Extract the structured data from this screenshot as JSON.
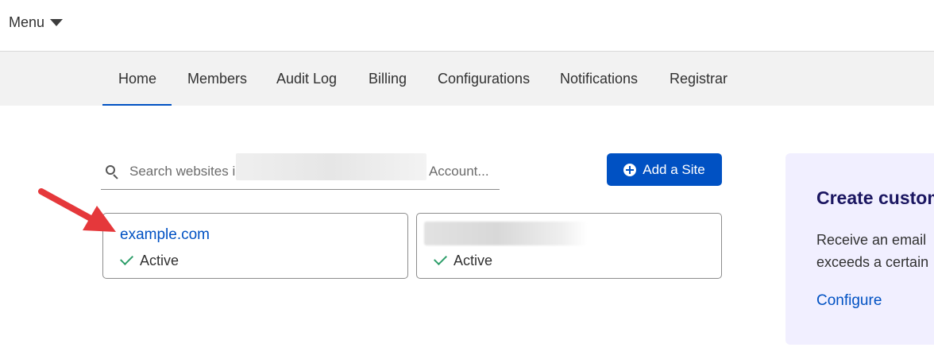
{
  "topbar": {
    "menu_label": "Menu"
  },
  "tabs": [
    {
      "label": "Home",
      "active": true
    },
    {
      "label": "Members"
    },
    {
      "label": "Audit Log"
    },
    {
      "label": "Billing"
    },
    {
      "label": "Configurations"
    },
    {
      "label": "Notifications"
    },
    {
      "label": "Registrar"
    }
  ],
  "search": {
    "placeholder": "Search websites in                                               s Account..."
  },
  "add_site": {
    "label": "Add a Site"
  },
  "sites": [
    {
      "name": "example.com",
      "status": "Active"
    },
    {
      "name": "",
      "status": "Active"
    }
  ],
  "promo": {
    "title": "Create custom",
    "text_line1": "Receive an email",
    "text_line2": "exceeds a certain",
    "link": "Configure"
  },
  "colors": {
    "accent": "#0051c3",
    "success": "#2e9e6a",
    "annotation": "#e5383b"
  }
}
